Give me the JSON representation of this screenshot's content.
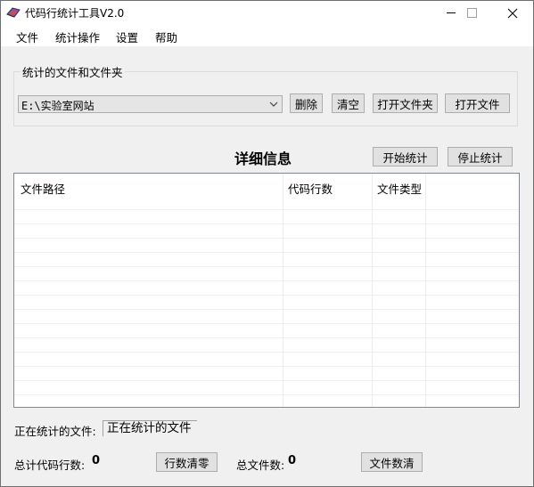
{
  "window": {
    "title": "代码行统计工具V2.0",
    "controls": {
      "minimize": "—",
      "maximize": "☐",
      "close": "✕"
    }
  },
  "menu": {
    "items": [
      "文件",
      "统计操作",
      "设置",
      "帮助"
    ]
  },
  "selection": {
    "group_label": "统计的文件和文件夹",
    "path_value": "E:\\实验室网站",
    "buttons": {
      "delete": "删除",
      "clear": "清空",
      "open_folder": "打开文件夹",
      "open_file": "打开文件"
    }
  },
  "detail": {
    "title": "详细信息",
    "start_button": "开始统计",
    "stop_button": "停止统计",
    "columns": [
      "文件路径",
      "代码行数",
      "文件类型"
    ],
    "rows": []
  },
  "status": {
    "current_label": "正在统计的文件:",
    "current_value": "正在统计的文件",
    "total_lines_label": "总计代码行数:",
    "total_lines_value": "0",
    "reset_lines_button": "行数清零",
    "total_files_label": "总文件数:",
    "total_files_value": "0",
    "reset_files_button": "文件数清"
  },
  "colors": {
    "title_bar": "#ffffff",
    "window_bg": "#f0f0f0",
    "button_bg": "#e1e1e1",
    "button_border": "#adadad",
    "list_bg": "#ffffff"
  },
  "icons": {
    "app": "app-icon",
    "combo_arrow": "chevron-down-icon"
  }
}
